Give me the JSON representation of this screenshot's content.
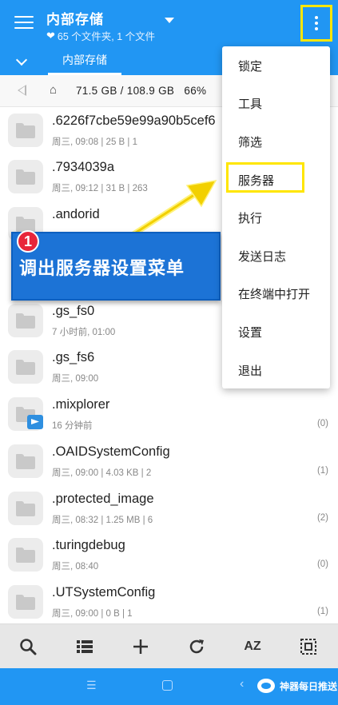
{
  "header": {
    "title": "内部存储",
    "subtitle": "65 个文件夹, 1 个文件",
    "tab_label": "内部存储"
  },
  "storage": {
    "usage": "71.5 GB / 108.9 GB",
    "percent": "66%"
  },
  "files": [
    {
      "name": ".6226f7cbe59e99a90b5cef6",
      "meta": "周三, 09:08 | 25 B | 1",
      "count": ""
    },
    {
      "name": ".7934039a",
      "meta": "周三, 09:12 | 31 B | 263",
      "count": ""
    },
    {
      "name": ".andorid",
      "meta": "",
      "count": ""
    },
    {
      "name": ".gs_fs0",
      "meta": "7 小时前, 01:00",
      "count": ""
    },
    {
      "name": ".gs_fs6",
      "meta": "周三, 09:00",
      "count": ""
    },
    {
      "name": ".mixplorer",
      "meta": "16 分钟前",
      "count": "(0)"
    },
    {
      "name": ".OAIDSystemConfig",
      "meta": "周三, 09:00 | 4.03 KB | 2",
      "count": "(1)"
    },
    {
      "name": ".protected_image",
      "meta": "周三, 08:32 | 1.25 MB | 6",
      "count": "(2)"
    },
    {
      "name": ".turingdebug",
      "meta": "周三, 08:40",
      "count": "(0)"
    },
    {
      "name": ".UTSystemConfig",
      "meta": "周三, 09:00 | 0 B | 1",
      "count": "(1)"
    }
  ],
  "menu": {
    "items": [
      "锁定",
      "工具",
      "筛选",
      "服务器",
      "执行",
      "发送日志",
      "在终端中打开",
      "设置",
      "退出"
    ],
    "highlighted": "服务器"
  },
  "callout": {
    "number": "1",
    "text": "调出服务器设置菜单"
  },
  "toolbar": {
    "sort_label": "AZ"
  },
  "navbar": {
    "watermark": "神器每日推送"
  },
  "colors": {
    "primary": "#2196f3",
    "highlight_border": "#ffe600",
    "callout_bg": "#1c73d6",
    "callout_badge": "#e8263a"
  }
}
